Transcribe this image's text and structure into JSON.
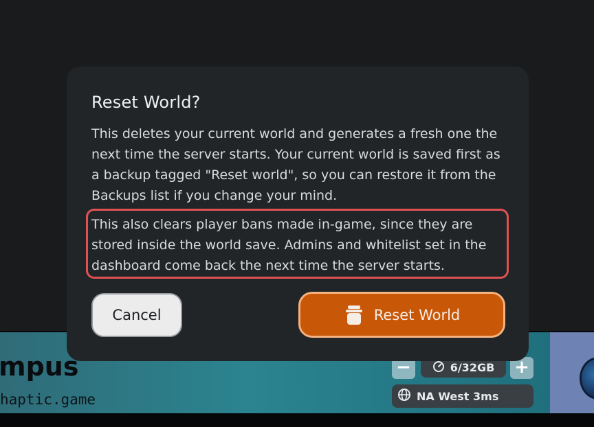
{
  "background": {
    "server_name_fragment": "mpus",
    "server_domain_fragment": "haptic.game",
    "memory_usage": "6/32GB",
    "region_label": "NA West 3ms",
    "minus_symbol": "−",
    "plus_symbol": "+"
  },
  "modal": {
    "title": "Reset World?",
    "body": "This deletes your current world and generates a fresh one the next time the server starts. Your current world is saved first as a backup tagged \"Reset world\", so you can restore it from the Backups list if you change your mind.",
    "warning": "This also clears player bans made in-game, since they are stored inside the world save. Admins and whitelist set in the dashboard come back the next time the server starts.",
    "cancel_label": "Cancel",
    "confirm_label": "Reset World",
    "confirm_icon": "trash-icon"
  },
  "colors": {
    "modal_bg": "#222528",
    "accent_orange": "#c95708",
    "accent_orange_border": "#f3b27f",
    "warning_border": "#e05252"
  }
}
